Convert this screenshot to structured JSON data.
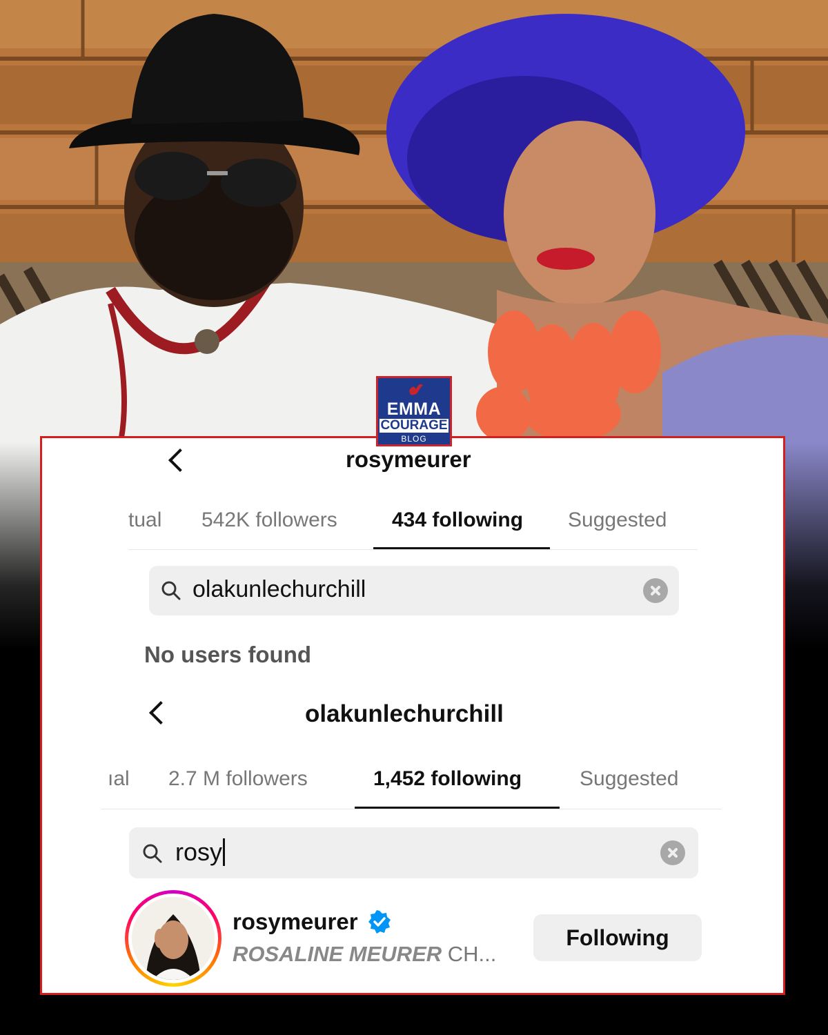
{
  "logo": {
    "line1": "EMMA",
    "line2": "COURAGE",
    "line3": "BLOG"
  },
  "panel1": {
    "username": "rosymeurer",
    "tabs": [
      "tual",
      "542K followers",
      "434 following",
      "Suggested"
    ],
    "active_tab": "434 following",
    "search_value": "olakunlechurchill",
    "empty_message": "No users found"
  },
  "panel2": {
    "username": "olakunlechurchill",
    "tabs": [
      "ıal",
      "2.7 M followers",
      "1,452 following",
      "Suggested"
    ],
    "active_tab": "1,452 following",
    "search_value": "rosy",
    "result": {
      "username": "rosymeurer",
      "verified": true,
      "subtitle_italic": "ROSALINE MEURER",
      "subtitle_rest": " CH...",
      "button_label": "Following"
    }
  },
  "colors": {
    "border": "#d51e1e",
    "verified": "#0095f6",
    "logo_bg": "#1f3a8c"
  },
  "icons": [
    "back-chevron-icon",
    "search-icon",
    "clear-icon",
    "verified-badge-icon",
    "dove-icon"
  ]
}
